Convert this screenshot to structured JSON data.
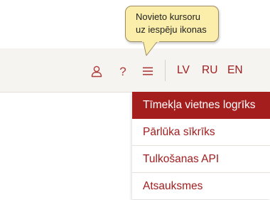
{
  "tooltip": {
    "line1": "Novieto kursoru",
    "line2": "uz iespēju ikonas"
  },
  "header": {
    "icons": {
      "user": "user-icon",
      "help": "help-icon",
      "menu": "menu-icon"
    },
    "help_label": "?",
    "languages": [
      "LV",
      "RU",
      "EN"
    ]
  },
  "dropdown": {
    "items": [
      {
        "label": "Tīmekļa vietnes logrīks",
        "active": true
      },
      {
        "label": "Pārlūka sīkrīks",
        "active": false
      },
      {
        "label": "Tulkošanas API",
        "active": false
      },
      {
        "label": "Atsauksmes",
        "active": false
      }
    ]
  },
  "colors": {
    "accent": "#a11d1d",
    "active_bg": "#a51e1e",
    "header_bg": "#f5f4f1",
    "tooltip_bg": "#fbeeaa"
  }
}
